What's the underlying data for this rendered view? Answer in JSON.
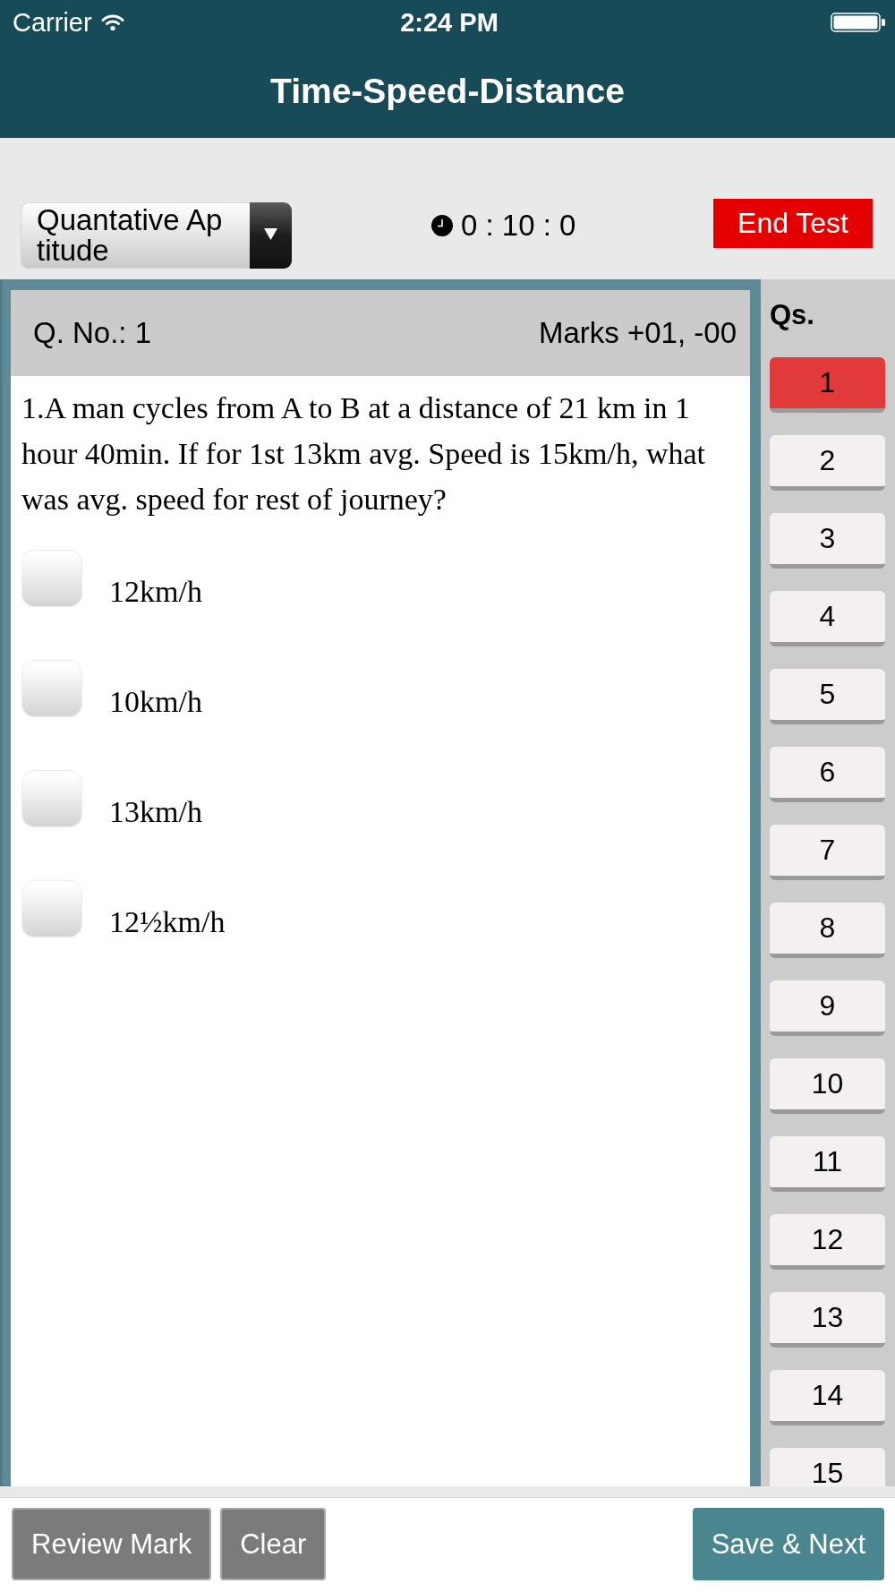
{
  "status_bar": {
    "carrier": "Carrier",
    "time": "2:24 PM"
  },
  "header": {
    "title": "Time-Speed-Distance"
  },
  "toolbar": {
    "section": "Quantative Aptitude",
    "timer": "0 : 10 : 0",
    "end_button": "End Test"
  },
  "question": {
    "number": "Q. No.: 1",
    "marks": "Marks +01, -00",
    "text": "1.A man cycles from A to B at a distance of 21 km in 1 hour 40min. If for 1st 13km avg. Speed is 15km/h, what was avg. speed for rest of journey?",
    "options": [
      {
        "label": "12km/h",
        "selected": false
      },
      {
        "label": "10km/h",
        "selected": false
      },
      {
        "label": "13km/h",
        "selected": false
      },
      {
        "label": "12½km/h",
        "selected": false
      }
    ]
  },
  "sidebar": {
    "heading": "Qs.",
    "questions": [
      {
        "label": "1",
        "selected": true
      },
      {
        "label": "2",
        "selected": false
      },
      {
        "label": "3",
        "selected": false
      },
      {
        "label": "4",
        "selected": false
      },
      {
        "label": "5",
        "selected": false
      },
      {
        "label": "6",
        "selected": false
      },
      {
        "label": "7",
        "selected": false
      },
      {
        "label": "8",
        "selected": false
      },
      {
        "label": "9",
        "selected": false
      },
      {
        "label": "10",
        "selected": false
      },
      {
        "label": "11",
        "selected": false
      },
      {
        "label": "12",
        "selected": false
      },
      {
        "label": "13",
        "selected": false
      },
      {
        "label": "14",
        "selected": false
      },
      {
        "label": "15",
        "selected": false
      }
    ]
  },
  "footer": {
    "buttons": [
      {
        "label": "Review Mark",
        "kind": "secondary"
      },
      {
        "label": "Clear",
        "kind": "secondary"
      },
      {
        "label": "Save & Next",
        "kind": "primary"
      }
    ]
  }
}
